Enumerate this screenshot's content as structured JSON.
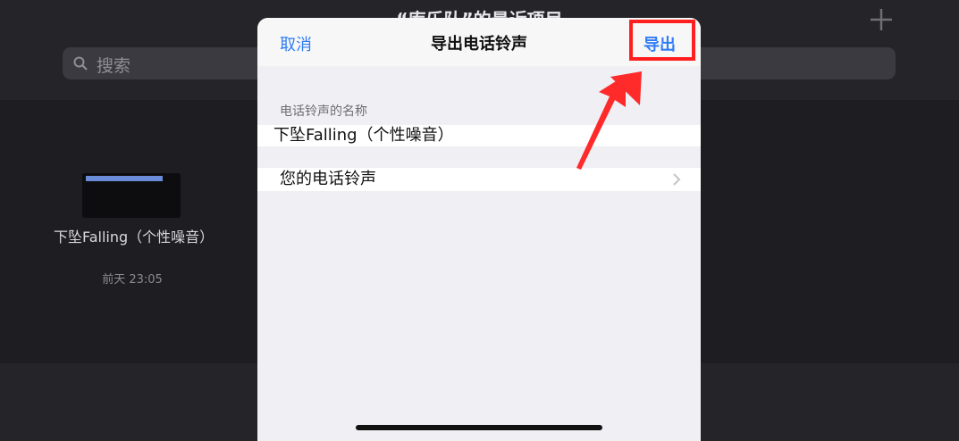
{
  "background": {
    "title": "“库乐队”的最近项目",
    "search_placeholder": "搜索",
    "project": {
      "name": "下坠Falling（个性噪音）",
      "date": "前天 23:05"
    }
  },
  "dialog": {
    "cancel_label": "取消",
    "title": "导出电话铃声",
    "export_label": "导出",
    "section_label": "电话铃声的名称",
    "ringtone_name_value": "下坠Falling（个性噪音）",
    "your_ringtones_label": "您的电话铃声"
  },
  "colors": {
    "accent": "#2f7cf6",
    "annotation": "#ff1f1f",
    "sheet_bg": "#efeff4",
    "backdrop": "#1d1d22"
  },
  "icons": {
    "search": "search-icon",
    "add": "plus-icon",
    "disclosure": "chevron-right-icon"
  }
}
